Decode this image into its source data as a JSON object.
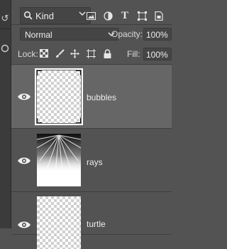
{
  "filter": {
    "kind_label": "Kind",
    "icons": [
      "image-filter-icon",
      "adjustment-filter-icon",
      "type-filter-icon",
      "shape-filter-icon",
      "smart-object-filter-icon"
    ]
  },
  "blend": {
    "mode": "Normal",
    "opacity_label": "Opacity:",
    "opacity_value": "100%",
    "lock_label": "Lock:",
    "fill_label": "Fill:",
    "fill_value": "100%"
  },
  "layers": [
    {
      "name": "bubbles",
      "visible": true,
      "selected": true
    },
    {
      "name": "rays",
      "visible": true,
      "selected": false
    },
    {
      "name": "turtle",
      "visible": true,
      "selected": false
    }
  ],
  "colors": {
    "panel_bg": "#535353",
    "selected_layer_bg": "#666666",
    "field_bg": "#454545"
  }
}
